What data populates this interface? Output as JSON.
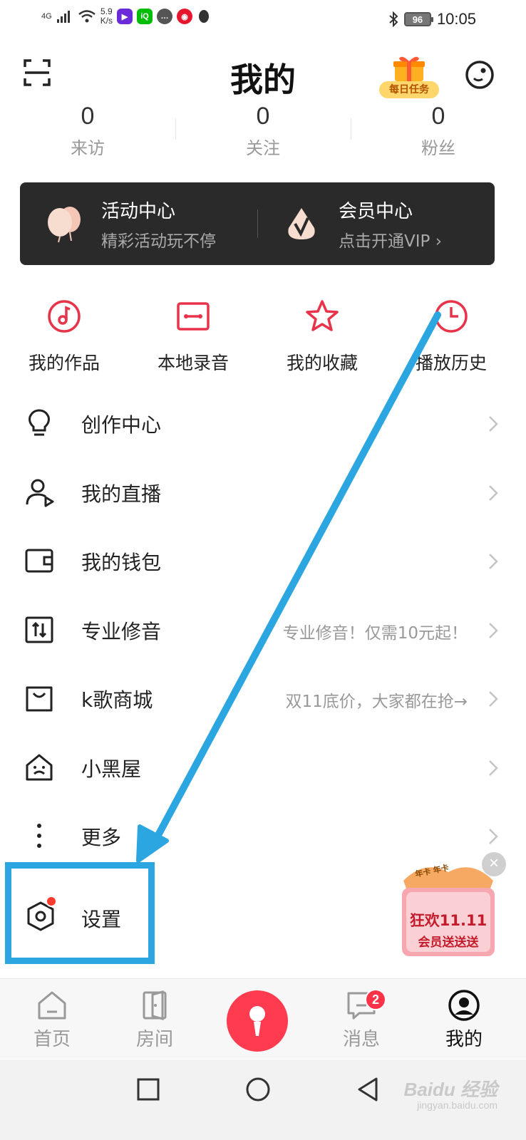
{
  "status_bar": {
    "network": "4G",
    "speed_value": "5.9",
    "speed_unit": "K/s",
    "battery": "96",
    "time": "10:05",
    "apps": [
      {
        "icon": "video-app-icon",
        "color": "#6b2bd9"
      },
      {
        "icon": "iqiyi-icon",
        "color": "#00be06"
      },
      {
        "icon": "chat-bubble-icon",
        "color": "#555555"
      },
      {
        "icon": "weibo-icon",
        "color": "#e6162d"
      },
      {
        "icon": "qq-penguin-icon",
        "color": "#333333"
      }
    ]
  },
  "header": {
    "title": "我的",
    "daily_task_label": "每日任务"
  },
  "stats": [
    {
      "value": "0",
      "label": "来访"
    },
    {
      "value": "0",
      "label": "关注"
    },
    {
      "value": "0",
      "label": "粉丝"
    }
  ],
  "banner": {
    "activity": {
      "title": "活动中心",
      "subtitle": "精彩活动玩不停"
    },
    "vip": {
      "title": "会员中心",
      "subtitle": "点击开通VIP ›"
    }
  },
  "quick_actions": [
    {
      "label": "我的作品",
      "icon": "music-disc-icon"
    },
    {
      "label": "本地录音",
      "icon": "cassette-icon"
    },
    {
      "label": "我的收藏",
      "icon": "star-icon"
    },
    {
      "label": "播放历史",
      "icon": "clock-icon"
    }
  ],
  "menu": [
    {
      "label": "创作中心",
      "hint": "",
      "icon": "lightbulb-icon"
    },
    {
      "label": "我的直播",
      "hint": "",
      "icon": "live-user-icon"
    },
    {
      "label": "我的钱包",
      "hint": "",
      "icon": "wallet-icon"
    },
    {
      "label": "专业修音",
      "hint": "专业修音！仅需10元起！",
      "icon": "adjust-icon"
    },
    {
      "label": "k歌商城",
      "hint": "双11底价，大家都在抢→",
      "icon": "shopping-bag-icon"
    },
    {
      "label": "小黑屋",
      "hint": "",
      "icon": "house-icon"
    },
    {
      "label": "更多",
      "hint": "",
      "icon": "more-vertical-icon"
    }
  ],
  "settings": {
    "label": "设置"
  },
  "promo": {
    "line1": "狂欢11.11",
    "line2": "会员送送送",
    "ribbon": "年卡 年卡",
    "close": "×"
  },
  "bottom_nav": [
    {
      "label": "首页",
      "icon": "home-icon"
    },
    {
      "label": "房间",
      "icon": "room-door-icon"
    },
    {
      "label": "消息",
      "icon": "message-icon",
      "badge": "2"
    },
    {
      "label": "我的",
      "icon": "profile-icon"
    }
  ],
  "watermark": {
    "brand": "Baidu 经验",
    "url": "jingyan.baidu.com"
  },
  "colors": {
    "accent": "#fe3b4f",
    "annotation": "#2ba6e1",
    "banner_bg": "#2a2a2a"
  }
}
